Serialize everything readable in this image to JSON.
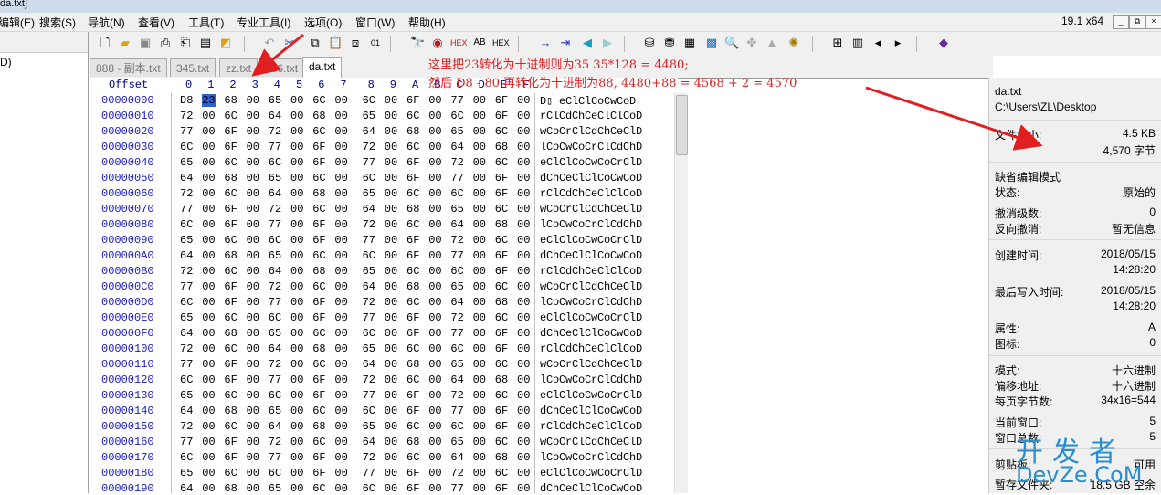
{
  "window": {
    "title_fragment": "da.txt]",
    "version": "19.1 x64",
    "win_buttons": [
      "_",
      "⧉",
      "×"
    ]
  },
  "menu": [
    "编辑(E)",
    "搜索(S)",
    "导航(N)",
    "查看(V)",
    "工具(T)",
    "专业工具(I)",
    "选项(O)",
    "窗口(W)",
    "帮助(H)"
  ],
  "leftpane": {
    "label": "D)"
  },
  "tabs": [
    "888 - 副本.txt",
    "345.txt",
    "zz.txt",
    "456.txt",
    "da.txt"
  ],
  "active_tab": 4,
  "hex": {
    "offset_header": "Offset",
    "col_headers": [
      "0",
      "1",
      "2",
      "3",
      "4",
      "5",
      "6",
      "7",
      "8",
      "9",
      "A",
      "B",
      "C",
      "D",
      "E",
      "F"
    ],
    "offsets": [
      "00000000",
      "00000010",
      "00000020",
      "00000030",
      "00000040",
      "00000050",
      "00000060",
      "00000070",
      "00000080",
      "00000090",
      "000000A0",
      "000000B0",
      "000000C0",
      "000000D0",
      "000000E0",
      "000000F0",
      "00000100",
      "00000110",
      "00000120",
      "00000130",
      "00000140",
      "00000150",
      "00000160",
      "00000170",
      "00000180",
      "00000190"
    ],
    "rows": [
      [
        "D8",
        "23",
        "68",
        "00",
        "65",
        "00",
        "6C",
        "00",
        "6C",
        "00",
        "6F",
        "00",
        "77",
        "00",
        "6F",
        "00"
      ],
      [
        "72",
        "00",
        "6C",
        "00",
        "64",
        "00",
        "68",
        "00",
        "65",
        "00",
        "6C",
        "00",
        "6C",
        "00",
        "6F",
        "00"
      ],
      [
        "77",
        "00",
        "6F",
        "00",
        "72",
        "00",
        "6C",
        "00",
        "64",
        "00",
        "68",
        "00",
        "65",
        "00",
        "6C",
        "00"
      ],
      [
        "6C",
        "00",
        "6F",
        "00",
        "77",
        "00",
        "6F",
        "00",
        "72",
        "00",
        "6C",
        "00",
        "64",
        "00",
        "68",
        "00"
      ],
      [
        "65",
        "00",
        "6C",
        "00",
        "6C",
        "00",
        "6F",
        "00",
        "77",
        "00",
        "6F",
        "00",
        "72",
        "00",
        "6C",
        "00"
      ],
      [
        "64",
        "00",
        "68",
        "00",
        "65",
        "00",
        "6C",
        "00",
        "6C",
        "00",
        "6F",
        "00",
        "77",
        "00",
        "6F",
        "00"
      ],
      [
        "72",
        "00",
        "6C",
        "00",
        "64",
        "00",
        "68",
        "00",
        "65",
        "00",
        "6C",
        "00",
        "6C",
        "00",
        "6F",
        "00"
      ],
      [
        "77",
        "00",
        "6F",
        "00",
        "72",
        "00",
        "6C",
        "00",
        "64",
        "00",
        "68",
        "00",
        "65",
        "00",
        "6C",
        "00"
      ],
      [
        "6C",
        "00",
        "6F",
        "00",
        "77",
        "00",
        "6F",
        "00",
        "72",
        "00",
        "6C",
        "00",
        "64",
        "00",
        "68",
        "00"
      ],
      [
        "65",
        "00",
        "6C",
        "00",
        "6C",
        "00",
        "6F",
        "00",
        "77",
        "00",
        "6F",
        "00",
        "72",
        "00",
        "6C",
        "00"
      ],
      [
        "64",
        "00",
        "68",
        "00",
        "65",
        "00",
        "6C",
        "00",
        "6C",
        "00",
        "6F",
        "00",
        "77",
        "00",
        "6F",
        "00"
      ],
      [
        "72",
        "00",
        "6C",
        "00",
        "64",
        "00",
        "68",
        "00",
        "65",
        "00",
        "6C",
        "00",
        "6C",
        "00",
        "6F",
        "00"
      ],
      [
        "77",
        "00",
        "6F",
        "00",
        "72",
        "00",
        "6C",
        "00",
        "64",
        "00",
        "68",
        "00",
        "65",
        "00",
        "6C",
        "00"
      ],
      [
        "6C",
        "00",
        "6F",
        "00",
        "77",
        "00",
        "6F",
        "00",
        "72",
        "00",
        "6C",
        "00",
        "64",
        "00",
        "68",
        "00"
      ],
      [
        "65",
        "00",
        "6C",
        "00",
        "6C",
        "00",
        "6F",
        "00",
        "77",
        "00",
        "6F",
        "00",
        "72",
        "00",
        "6C",
        "00"
      ],
      [
        "64",
        "00",
        "68",
        "00",
        "65",
        "00",
        "6C",
        "00",
        "6C",
        "00",
        "6F",
        "00",
        "77",
        "00",
        "6F",
        "00"
      ],
      [
        "72",
        "00",
        "6C",
        "00",
        "64",
        "00",
        "68",
        "00",
        "65",
        "00",
        "6C",
        "00",
        "6C",
        "00",
        "6F",
        "00"
      ],
      [
        "77",
        "00",
        "6F",
        "00",
        "72",
        "00",
        "6C",
        "00",
        "64",
        "00",
        "68",
        "00",
        "65",
        "00",
        "6C",
        "00"
      ],
      [
        "6C",
        "00",
        "6F",
        "00",
        "77",
        "00",
        "6F",
        "00",
        "72",
        "00",
        "6C",
        "00",
        "64",
        "00",
        "68",
        "00"
      ],
      [
        "65",
        "00",
        "6C",
        "00",
        "6C",
        "00",
        "6F",
        "00",
        "77",
        "00",
        "6F",
        "00",
        "72",
        "00",
        "6C",
        "00"
      ],
      [
        "64",
        "00",
        "68",
        "00",
        "65",
        "00",
        "6C",
        "00",
        "6C",
        "00",
        "6F",
        "00",
        "77",
        "00",
        "6F",
        "00"
      ],
      [
        "72",
        "00",
        "6C",
        "00",
        "64",
        "00",
        "68",
        "00",
        "65",
        "00",
        "6C",
        "00",
        "6C",
        "00",
        "6F",
        "00"
      ],
      [
        "77",
        "00",
        "6F",
        "00",
        "72",
        "00",
        "6C",
        "00",
        "64",
        "00",
        "68",
        "00",
        "65",
        "00",
        "6C",
        "00"
      ],
      [
        "6C",
        "00",
        "6F",
        "00",
        "77",
        "00",
        "6F",
        "00",
        "72",
        "00",
        "6C",
        "00",
        "64",
        "00",
        "68",
        "00"
      ],
      [
        "65",
        "00",
        "6C",
        "00",
        "6C",
        "00",
        "6F",
        "00",
        "77",
        "00",
        "6F",
        "00",
        "72",
        "00",
        "6C",
        "00"
      ],
      [
        "64",
        "00",
        "68",
        "00",
        "65",
        "00",
        "6C",
        "00",
        "6C",
        "00",
        "6F",
        "00",
        "77",
        "00",
        "6F",
        "00"
      ]
    ],
    "ascii": [
      "D▯ eClClCoCwCoD",
      "rClCdChCeClClCoD",
      "wCoCrClCdChCeClD",
      "lCoCwCoCrClCdChD",
      "eClClCoCwCoCrClD",
      "dChCeClClCoCwCoD",
      "rClCdChCeClClCoD",
      "wCoCrClCdChCeClD",
      "lCoCwCoCrClCdChD",
      "eClClCoCwCoCrClD",
      "dChCeClClCoCwCoD",
      "rClCdChCeClClCoD",
      "wCoCrClCdChCeClD",
      "lCoCwCoCrClCdChD",
      "eClClCoCwCoCrClD",
      "dChCeClClCoCwCoD",
      "rClCdChCeClClCoD",
      "wCoCrClCdChCeClD",
      "lCoCwCoCrClCdChD",
      "eClClCoCwCoCrClD",
      "dChCeClClCoCwCoD",
      "rClCdChCeClClCoD",
      "wCoCrClCdChCeClD",
      "lCoCwCoCrClCdChD",
      "eClClCoCwCoCrClD",
      "dChCeClClCoCwCoD"
    ]
  },
  "annotation": {
    "line1": "这里把23转化为十进制则为35 35*128 = 4480;",
    "line2": "然后 D8 - 80 再转化为十进制为88,  4480+88 = 4568 + 2 = 4570"
  },
  "info": {
    "filename": "da.txt",
    "path": "C:\\Users\\ZL\\Desktop",
    "filesize_label": "文件大小:",
    "filesize_kb": "4.5 KB",
    "filesize_bytes": "4,570 字节",
    "edit_mode": "缺省编辑模式",
    "state_label": "状态:",
    "state_value": "原始的",
    "undo_label": "撤消级数:",
    "undo_value": "0",
    "redo_label": "反向撤消:",
    "redo_value": "暂无信息",
    "created_label": "创建时间:",
    "created_date": "2018/05/15",
    "created_time": "14:28:20",
    "modified_label": "最后写入时间:",
    "modified_date": "2018/05/15",
    "modified_time": "14:28:20",
    "attr_label": "属性:",
    "attr_value": "A",
    "icon_label": "图标:",
    "icon_value": "0",
    "mode_label": "模式:",
    "mode_value": "十六进制",
    "offset_label": "偏移地址:",
    "offset_value": "十六进制",
    "bpp_label": "每页字节数:",
    "bpp_value": "34x16=544",
    "curwin_label": "当前窗口:",
    "curwin_value": "5",
    "wincount_label": "窗口总数:",
    "wincount_value": "5",
    "clipboard_label": "剪贴板:",
    "clipboard_value": "可用",
    "temp_label": "暂存文件夹:",
    "temp_value": "18.5 GB 空余"
  },
  "watermark": {
    "line1": "开发者",
    "line2": "DevZe.CoM"
  },
  "colors": {
    "annotation": "#e02020",
    "offset": "#1a1ac8",
    "cursor": "#2d5fd6",
    "watermark": "#2a8fd0"
  }
}
